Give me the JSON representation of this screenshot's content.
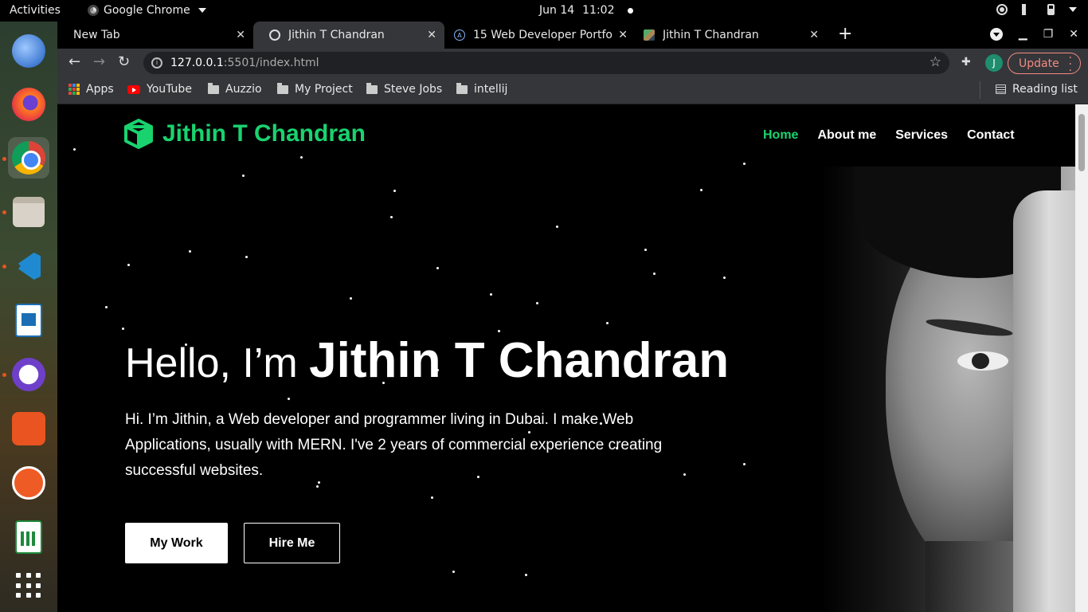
{
  "system": {
    "activities": "Activities",
    "app_name": "Google Chrome",
    "date": "Jun 14",
    "time": "11:02"
  },
  "tabs": [
    {
      "label": "New Tab",
      "active": false
    },
    {
      "label": "Jithin T Chandran",
      "active": true
    },
    {
      "label": "15 Web Developer Portfol",
      "active": false
    },
    {
      "label": "Jithin T Chandran",
      "active": false
    }
  ],
  "omnibox": {
    "host": "127.0.0.1",
    "path": ":5501/index.html"
  },
  "profile_initial": "J",
  "update_label": "Update",
  "bookmarks": [
    {
      "label": "Apps",
      "icon": "apps-grid-icon"
    },
    {
      "label": "YouTube",
      "icon": "youtube-icon"
    },
    {
      "label": "Auzzio",
      "icon": "folder-icon"
    },
    {
      "label": "My Project",
      "icon": "folder-icon"
    },
    {
      "label": "Steve Jobs",
      "icon": "folder-icon"
    },
    {
      "label": "intellij",
      "icon": "folder-icon"
    }
  ],
  "reading_list": "Reading list",
  "site": {
    "logo_text": "Jithin T Chandran",
    "accent_color": "#19d36f",
    "nav": [
      {
        "label": "Home",
        "active": true
      },
      {
        "label": "About me",
        "active": false
      },
      {
        "label": "Services",
        "active": false
      },
      {
        "label": "Contact",
        "active": false
      }
    ],
    "hero": {
      "greeting": "Hello, I’m ",
      "name": "Jithin T Chandran",
      "description": "Hi. I’m Jithin, a Web developer and programmer living in Dubai. I make Web Applications, usually with MERN. I've 2 years of commercial experience creating successful websites.",
      "primary_button": "My Work",
      "secondary_button": "Hire Me"
    }
  },
  "dock": [
    "thunderbird-icon",
    "firefox-icon",
    "chrome-icon",
    "files-icon",
    "vscode-icon",
    "writer-icon",
    "github-desktop-icon",
    "software-store-icon",
    "postman-icon",
    "calc-icon",
    "show-apps-icon"
  ]
}
